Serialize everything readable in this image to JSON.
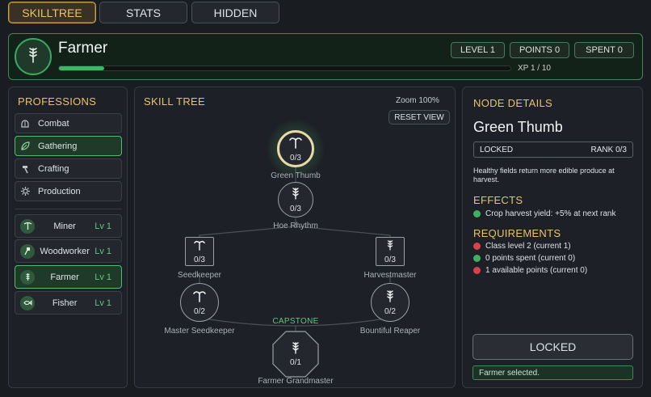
{
  "tabs": [
    "SKILLTREE",
    "STATS",
    "HIDDEN"
  ],
  "header": {
    "name": "Farmer",
    "level": "LEVEL 1",
    "points": "POINTS 0",
    "spent": "SPENT 0",
    "xp_text": "XP 1 / 10",
    "xp_progress": 0.1
  },
  "professions": {
    "title": "PROFESSIONS",
    "categories": [
      {
        "label": "Combat",
        "icon": "helmet-icon"
      },
      {
        "label": "Gathering",
        "icon": "leaf-icon"
      },
      {
        "label": "Crafting",
        "icon": "hammer-icon"
      },
      {
        "label": "Production",
        "icon": "gear-icon"
      }
    ],
    "classes": [
      {
        "name": "Miner",
        "level": "Lv 1",
        "icon": "pickaxe-icon"
      },
      {
        "name": "Woodworker",
        "level": "Lv 1",
        "icon": "axe-icon"
      },
      {
        "name": "Farmer",
        "level": "Lv 1",
        "icon": "wheat-icon"
      },
      {
        "name": "Fisher",
        "level": "Lv 1",
        "icon": "fish-icon"
      }
    ]
  },
  "tree": {
    "title": "SKILL TREE",
    "zoom": "Zoom 100%",
    "reset": "RESET VIEW",
    "capstone": "CAPSTONE",
    "nodes": {
      "green_thumb": {
        "label": "Green Thumb",
        "count": "0/3",
        "icon": "sprout-icon"
      },
      "hoe_rhythm": {
        "label": "Hoe Rhythm",
        "count": "0/3",
        "icon": "wheat-icon"
      },
      "seedkeeper": {
        "label": "Seedkeeper",
        "count": "0/3",
        "icon": "sprout-icon"
      },
      "harvestmaster": {
        "label": "Harvestmaster",
        "count": "0/3",
        "icon": "wheat-icon"
      },
      "master_seedkeeper": {
        "label": "Master Seedkeeper",
        "count": "0/2",
        "icon": "sprout-icon"
      },
      "bountiful_reaper": {
        "label": "Bountiful Reaper",
        "count": "0/2",
        "icon": "wheat-icon"
      },
      "farmer_grandmaster": {
        "label": "Farmer Grandmaster",
        "count": "0/1",
        "icon": "wheat-icon"
      }
    }
  },
  "details": {
    "title": "NODE DETAILS",
    "node_name": "Green Thumb",
    "state": "LOCKED",
    "rank": "RANK 0/3",
    "description": "Healthy fields return more edible produce at harvest.",
    "effects_title": "EFFECTS",
    "effects": [
      "Crop harvest yield: +5% at next rank"
    ],
    "requirements_title": "REQUIREMENTS",
    "requirements": [
      {
        "text": "Class level 2 (current 1)",
        "met": false
      },
      {
        "text": "0 points spent (current 0)",
        "met": true
      },
      {
        "text": "1 available points (current 0)",
        "met": false
      }
    ],
    "action": "LOCKED",
    "status": "Farmer selected."
  },
  "colors": {
    "accent_gold": "#e8c36b",
    "accent_green": "#4fbf6f",
    "bad_red": "#d9424a"
  }
}
